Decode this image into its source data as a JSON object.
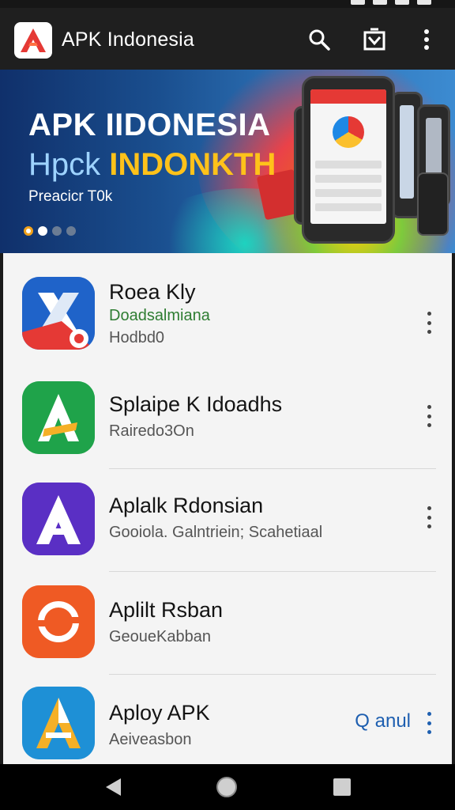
{
  "app_bar": {
    "title": "APK Indonesia",
    "logo_icon": "apk-logo-icon",
    "search_icon": "search-icon",
    "store_icon": "store-bag-icon",
    "menu_icon": "more-vertical-icon"
  },
  "banner": {
    "title": "APK IIDONESIA",
    "subtitle_a": "Hpck",
    "subtitle_b": "INDONKTH",
    "tagline": "Preacicr T0k",
    "slides_total": 4,
    "active_slide": 1
  },
  "apps": [
    {
      "name": "Roea Kly",
      "line1": "Doadsalmiana",
      "line2": "Hodbd0",
      "icon": "x-app-icon",
      "color": "#1f63c9"
    },
    {
      "name": "Splaipe K Idoadhs",
      "line1": "Rairedo3On",
      "line2": "",
      "icon": "a-green-app-icon",
      "color": "#1fa34a"
    },
    {
      "name": "Aplalk Rdonsian",
      "line1": "Gooiola. Galntriein; Scahetiaal",
      "line2": "",
      "icon": "a-purple-app-icon",
      "color": "#5a2fc4"
    },
    {
      "name": "Aplilt Rsban",
      "line1": "GeoueKabban",
      "line2": "",
      "icon": "refresh-app-icon",
      "color": "#ef5a24"
    },
    {
      "name": "Aploy APK",
      "line1": "Aeiveasbon",
      "line2": "",
      "icon": "a-blue-app-icon",
      "color": "#1e90d6",
      "action": "Q anul"
    }
  ],
  "nav": {
    "back_icon": "back-triangle-icon",
    "home_icon": "home-circle-icon",
    "recents_icon": "recents-square-icon"
  },
  "colors": {
    "app_bar_bg": "#1f1f1f",
    "list_bg": "#f4f4f4",
    "accent_yellow": "#ffc21a",
    "link_blue": "#1e5fb0"
  }
}
